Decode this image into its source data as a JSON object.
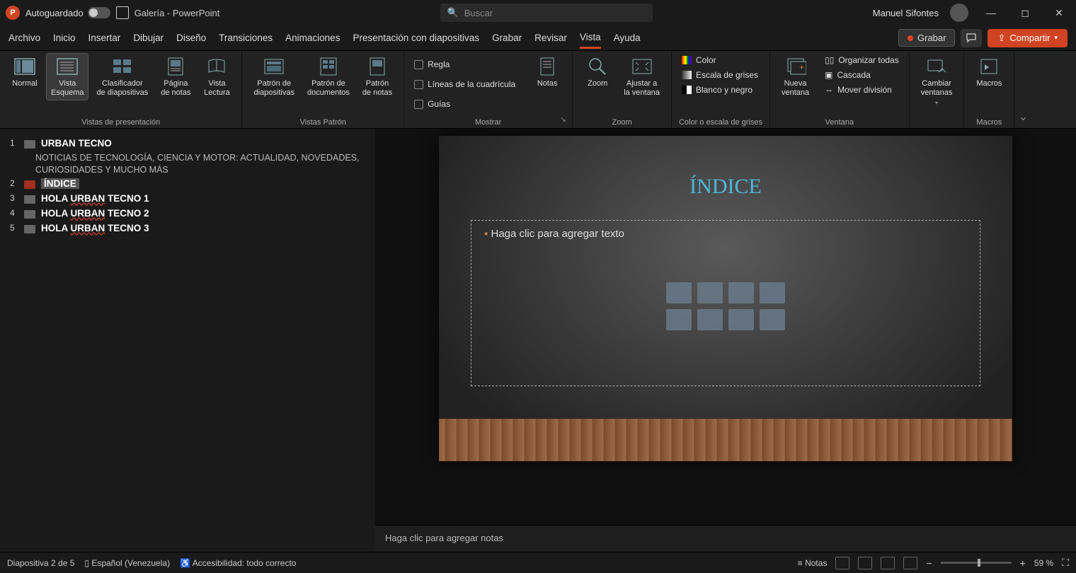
{
  "titlebar": {
    "autosave_label": "Autoguardado",
    "doc_title": "Galería - PowerPoint",
    "search_placeholder": "Buscar",
    "username": "Manuel Sifontes"
  },
  "tabs": {
    "items": [
      "Archivo",
      "Inicio",
      "Insertar",
      "Dibujar",
      "Diseño",
      "Transiciones",
      "Animaciones",
      "Presentación con diapositivas",
      "Grabar",
      "Revisar",
      "Vista",
      "Ayuda"
    ],
    "active": "Vista",
    "grabar_btn": "Grabar",
    "share_btn": "Compartir"
  },
  "ribbon": {
    "groups": {
      "presentacion": {
        "label": "Vistas de presentación",
        "normal": "Normal",
        "esquema": "Vista\nEsquema",
        "clasificador": "Clasificador\nde diapositivas",
        "pagina_notas": "Página\nde notas",
        "lectura": "Vista\nLectura"
      },
      "patron": {
        "label": "Vistas Patrón",
        "diapositivas": "Patrón de\ndiapositivas",
        "documentos": "Patrón de\ndocumentos",
        "notas": "Patrón\nde notas"
      },
      "mostrar": {
        "label": "Mostrar",
        "regla": "Regla",
        "cuadricula": "Líneas de la cuadrícula",
        "guias": "Guías",
        "notas": "Notas"
      },
      "zoom": {
        "label": "Zoom",
        "zoom": "Zoom",
        "ajustar": "Ajustar a\nla ventana"
      },
      "color": {
        "label": "Color o escala de grises",
        "color": "Color",
        "grises": "Escala de grises",
        "bn": "Blanco y negro"
      },
      "ventana": {
        "label": "Ventana",
        "nueva": "Nueva\nventana",
        "organizar": "Organizar todas",
        "cascada": "Cascada",
        "mover": "Mover división"
      },
      "cambiar": {
        "label": "",
        "cambiar": "Cambiar\nventanas"
      },
      "macros": {
        "label": "Macros",
        "macros": "Macros"
      }
    }
  },
  "outline": {
    "items": [
      {
        "num": "1",
        "title": "URBAN TECNO",
        "body": "NOTICIAS DE TECNOLOGÍA, CIENCIA Y MOTOR: ACTUALIDAD, NOVEDADES, CURIOSIDADES Y MUCHO MÁS"
      },
      {
        "num": "2",
        "title": "ÍNDICE",
        "selected": true
      },
      {
        "num": "3",
        "title_prefix": "HOLA ",
        "wavy": "URBAN",
        "title_suffix": " TECNO 1"
      },
      {
        "num": "4",
        "title_prefix": "HOLA ",
        "wavy": "URBAN",
        "title_suffix": " TECNO 2"
      },
      {
        "num": "5",
        "title_prefix": "HOLA ",
        "wavy": "URBAN",
        "title_suffix": " TECNO 3"
      }
    ]
  },
  "slide": {
    "title": "ÍNDICE",
    "content_placeholder": "Haga clic para agregar texto"
  },
  "notes": {
    "placeholder": "Haga clic para agregar notas"
  },
  "statusbar": {
    "slide_count": "Diapositiva 2 de 5",
    "language": "Español (Venezuela)",
    "accessibility": "Accesibilidad: todo correcto",
    "notas_btn": "Notas",
    "zoom_pct": "59 %"
  }
}
